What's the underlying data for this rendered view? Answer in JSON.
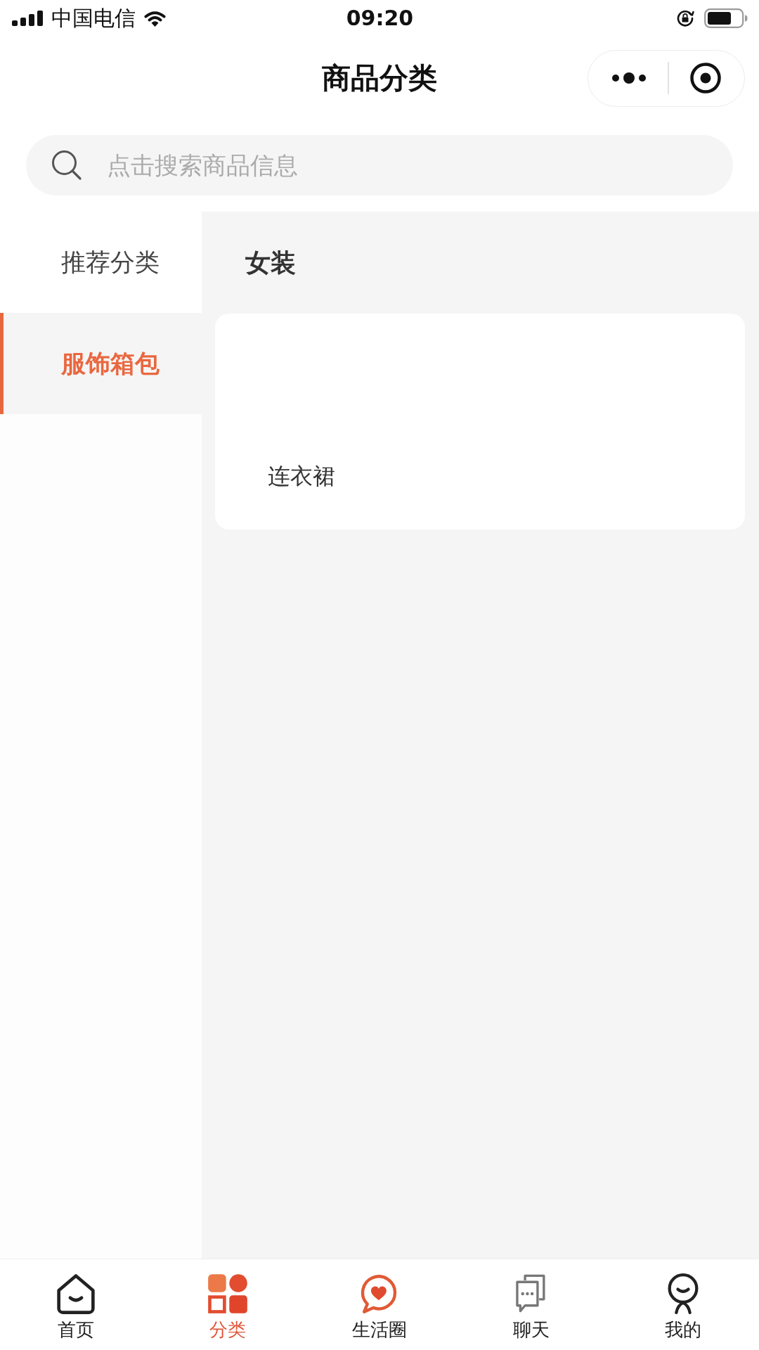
{
  "status_bar": {
    "carrier": "中国电信",
    "time": "09:20"
  },
  "header": {
    "title": "商品分类"
  },
  "search": {
    "placeholder": "点击搜索商品信息"
  },
  "sidebar": {
    "items": [
      {
        "label": "推荐分类",
        "selected": false
      },
      {
        "label": "服饰箱包",
        "selected": true
      }
    ]
  },
  "content": {
    "section_title": "女装",
    "subcategories": [
      {
        "label": "连衣裙"
      }
    ]
  },
  "tab_bar": {
    "items": [
      {
        "kind": "home",
        "label": "首页",
        "selected": false
      },
      {
        "kind": "category",
        "label": "分类",
        "selected": true
      },
      {
        "kind": "moments",
        "label": "生活圈",
        "selected": false
      },
      {
        "kind": "chat",
        "label": "聊天",
        "selected": false
      },
      {
        "kind": "profile",
        "label": "我的",
        "selected": false
      }
    ]
  }
}
